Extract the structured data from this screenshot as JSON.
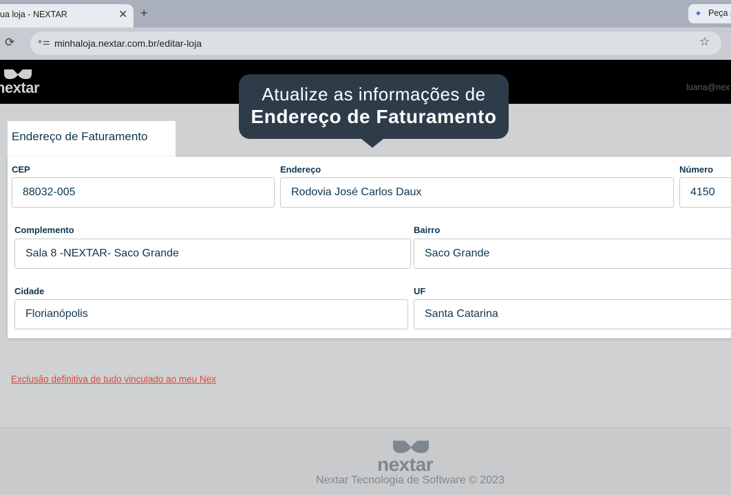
{
  "browser": {
    "tab_title": "ua loja - NEXTAR",
    "tab_close_icon": "close-icon",
    "new_tab_icon": "plus-icon",
    "side_tab_label": "Peça a",
    "address": "minhaloja.nextar.com.br/editar-loja"
  },
  "header": {
    "logo_text": "nextar",
    "user_email": "luana@nex"
  },
  "tooltip": {
    "line1": "Atualize as informações de",
    "line2": "Endereço de Faturamento"
  },
  "section": {
    "title": "Endereço de Faturamento"
  },
  "form": {
    "cep": {
      "label": "CEP",
      "value": "88032-005"
    },
    "endereco": {
      "label": "Endereço",
      "value": "Rodovia José Carlos Daux"
    },
    "numero": {
      "label": "Número",
      "value": "4150"
    },
    "complemento": {
      "label": "Complemento",
      "value": "Sala 8 -NEXTAR- Saco Grande"
    },
    "bairro": {
      "label": "Bairro",
      "value": "Saco Grande"
    },
    "cidade": {
      "label": "Cidade",
      "value": "Florianópolis"
    },
    "uf": {
      "label": "UF",
      "value": "Santa Catarina"
    }
  },
  "delete_link": "Exclusão definitiva de tudo vinculado ao meu Nex",
  "footer": {
    "logo_text": "nextar",
    "copyright": "Nextar Tecnologia de Software © 2023"
  },
  "colors": {
    "header_bg": "#000000",
    "label_color": "#0d3550",
    "danger_link": "#e0463a",
    "tooltip_bg": "#2e3c4a"
  }
}
